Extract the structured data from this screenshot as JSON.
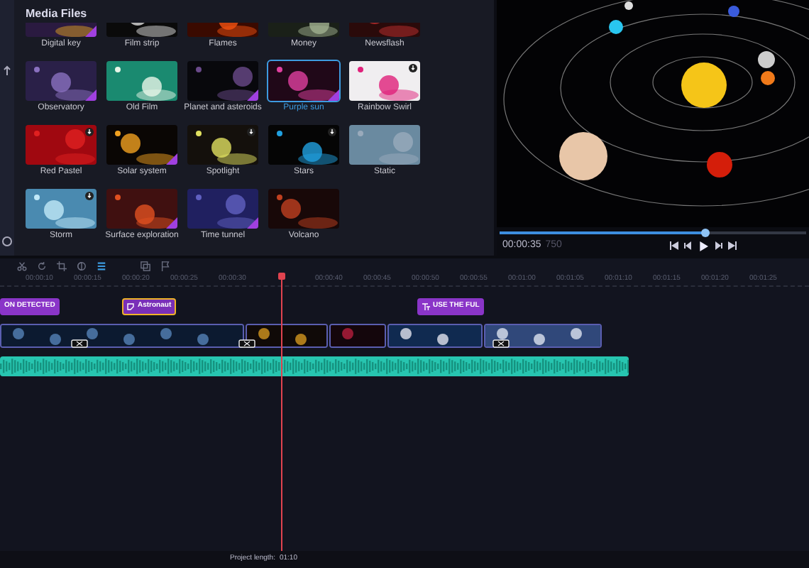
{
  "media_panel": {
    "title": "Media Files",
    "items": [
      {
        "label": "Digital key",
        "kind": "premium",
        "selected": false
      },
      {
        "label": "Film strip",
        "kind": "plain",
        "selected": false
      },
      {
        "label": "Flames",
        "kind": "plain",
        "selected": false
      },
      {
        "label": "Money",
        "kind": "plain",
        "selected": false
      },
      {
        "label": "Newsflash",
        "kind": "plain",
        "selected": false
      },
      {
        "label": "Observatory",
        "kind": "premium",
        "selected": false
      },
      {
        "label": "Old Film",
        "kind": "plain",
        "selected": false
      },
      {
        "label": "Planet and asteroids",
        "kind": "premium",
        "selected": false
      },
      {
        "label": "Purple sun",
        "kind": "premium",
        "selected": true
      },
      {
        "label": "Rainbow Swirl",
        "kind": "download",
        "selected": false
      },
      {
        "label": "Red Pastel",
        "kind": "download",
        "selected": false
      },
      {
        "label": "Solar system",
        "kind": "premium",
        "selected": false
      },
      {
        "label": "Spotlight",
        "kind": "download",
        "selected": false
      },
      {
        "label": "Stars",
        "kind": "download",
        "selected": false
      },
      {
        "label": "Static",
        "kind": "plain",
        "selected": false
      },
      {
        "label": "Storm",
        "kind": "download",
        "selected": false
      },
      {
        "label": "Surface exploration",
        "kind": "premium",
        "selected": false
      },
      {
        "label": "Time tunnel",
        "kind": "premium",
        "selected": false
      },
      {
        "label": "Volcano",
        "kind": "plain",
        "selected": false
      }
    ]
  },
  "preview": {
    "level": 0.67,
    "time": "00:00:35",
    "frames": "750"
  },
  "edit_tools": [
    {
      "kind": "cut",
      "selected": false
    },
    {
      "kind": "rotate",
      "selected": false
    },
    {
      "kind": "crop",
      "selected": false
    },
    {
      "kind": "color",
      "selected": false
    },
    {
      "kind": "list",
      "selected": true
    }
  ],
  "view_tools": [
    {
      "kind": "copy",
      "selected": false
    },
    {
      "kind": "flag",
      "selected": false
    }
  ],
  "ruler": [
    "00:00:10",
    "00:00:15",
    "00:00:20",
    "00:00:25",
    "00:00:30",
    "00:00:40",
    "00:00:45",
    "00:00:50",
    "00:00:55",
    "00:01:00",
    "00:01:05",
    "00:01:10",
    "00:01:15",
    "00:01:20",
    "00:01:25"
  ],
  "captions": [
    {
      "kind": "text",
      "label": "ON DETECTED",
      "selected": false
    },
    {
      "kind": "sticker",
      "label": "Astronaut",
      "selected": true
    },
    {
      "kind": "text",
      "label": "USE THE FUL",
      "selected": false
    }
  ],
  "status_bar": {
    "label": "Project length:",
    "value": "01:10"
  }
}
